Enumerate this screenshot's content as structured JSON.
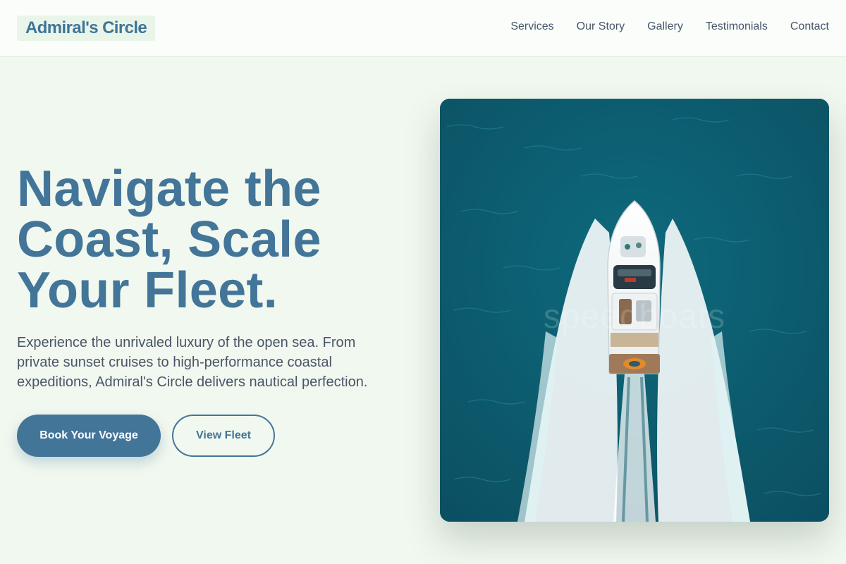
{
  "header": {
    "logo": "Admiral's Circle",
    "nav": [
      "Services",
      "Our Story",
      "Gallery",
      "Testimonials",
      "Contact"
    ]
  },
  "hero": {
    "title_lines": [
      "Navigate the",
      "Coast, Scale",
      "Your Fleet."
    ],
    "subtitle": "Experience the unrivaled luxury of the open sea. From private sunset cruises to high-performance coastal expeditions, Admiral's Circle delivers nautical perfection.",
    "primary_button": "Book Your Voyage",
    "secondary_button": "View Fleet",
    "image_watermark": "speedboats"
  },
  "colors": {
    "accent": "#437599",
    "background": "#f1f8ef",
    "water": "#0f6173"
  }
}
